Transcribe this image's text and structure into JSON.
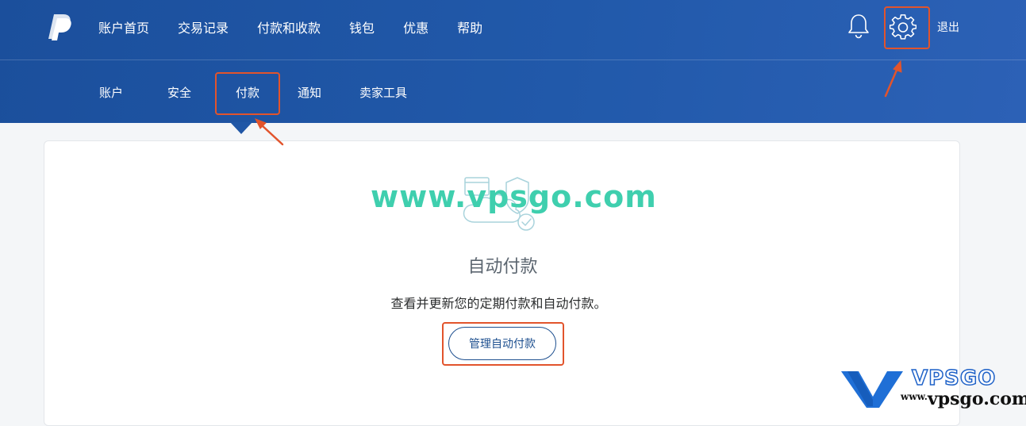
{
  "nav": {
    "items": [
      "账户首页",
      "交易记录",
      "付款和收款",
      "钱包",
      "优惠",
      "帮助"
    ],
    "logout": "退出"
  },
  "subnav": {
    "items": [
      "账户",
      "安全",
      "付款",
      "通知",
      "卖家工具"
    ],
    "active": "付款"
  },
  "card": {
    "title": "自动付款",
    "description": "查看并更新您的定期付款和自动付款。",
    "button_label": "管理自动付款"
  },
  "watermark": {
    "text": "www.vpsgo.com"
  },
  "brand": {
    "name": "VPSGO",
    "url_prefix": "www.",
    "url_main": "vpsgo.com"
  },
  "colors": {
    "header_bg": "#2159aa",
    "highlight": "#e2542c",
    "watermark": "#3fcfae",
    "button_text": "#1d4f8f"
  },
  "icons": {
    "logo": "paypal-logo-icon",
    "bell": "bell-icon",
    "settings": "gear-icon",
    "illustration": "cloud-shield-check-icon"
  }
}
